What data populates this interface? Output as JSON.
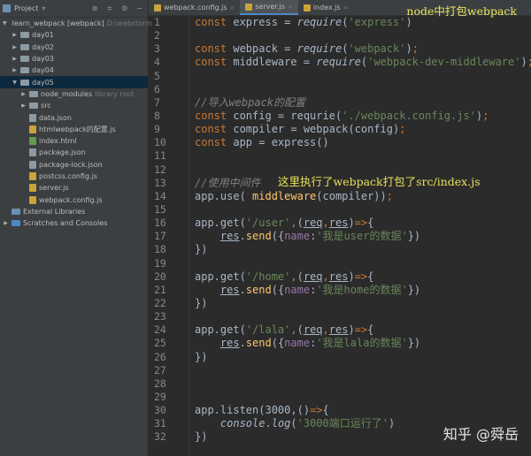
{
  "sidebar": {
    "title": "Project",
    "items": [
      {
        "label": "learn_webpack [webpack]",
        "hint": "D:\\webstorm",
        "depth": 0,
        "kind": "folder",
        "open": true
      },
      {
        "label": "day01",
        "depth": 1,
        "kind": "folder"
      },
      {
        "label": "day02",
        "depth": 1,
        "kind": "folder"
      },
      {
        "label": "day03",
        "depth": 1,
        "kind": "folder"
      },
      {
        "label": "day04",
        "depth": 1,
        "kind": "folder"
      },
      {
        "label": "day05",
        "depth": 1,
        "kind": "folder",
        "open": true,
        "selected": true
      },
      {
        "label": "node_modules",
        "hint": "library root",
        "depth": 2,
        "kind": "folder"
      },
      {
        "label": "src",
        "depth": 2,
        "kind": "folder"
      },
      {
        "label": "data.json",
        "depth": 2,
        "kind": "json"
      },
      {
        "label": "htmlwebpack的配置.js",
        "depth": 2,
        "kind": "js"
      },
      {
        "label": "index.html",
        "depth": 2,
        "kind": "html"
      },
      {
        "label": "package.json",
        "depth": 2,
        "kind": "json"
      },
      {
        "label": "package-lock.json",
        "depth": 2,
        "kind": "json"
      },
      {
        "label": "postcss.config.js",
        "depth": 2,
        "kind": "js"
      },
      {
        "label": "server.js",
        "depth": 2,
        "kind": "js"
      },
      {
        "label": "webpack.config.js",
        "depth": 2,
        "kind": "js"
      },
      {
        "label": "External Libraries",
        "depth": 0,
        "kind": "lib"
      },
      {
        "label": "Scratches and Consoles",
        "depth": 0,
        "kind": "scratch"
      }
    ]
  },
  "tabs": [
    {
      "label": "webpack.config.js"
    },
    {
      "label": "server.js",
      "active": true
    },
    {
      "label": "index.js"
    }
  ],
  "code": [
    [
      [
        "kw",
        "const "
      ],
      [
        "pl",
        "express = "
      ],
      [
        "it",
        "require"
      ],
      [
        "pl",
        "("
      ],
      [
        "str",
        "'express'"
      ],
      [
        "pl",
        ")"
      ]
    ],
    [],
    [
      [
        "kw",
        "const "
      ],
      [
        "pl",
        "webpack = "
      ],
      [
        "it",
        "require"
      ],
      [
        "pl",
        "("
      ],
      [
        "str",
        "'webpack'"
      ],
      [
        "pl",
        ")"
      ],
      [
        "kw",
        ";"
      ]
    ],
    [
      [
        "kw",
        "const "
      ],
      [
        "pl",
        "middleware = "
      ],
      [
        "it",
        "require"
      ],
      [
        "pl",
        "("
      ],
      [
        "str",
        "'webpack-dev-middleware'"
      ],
      [
        "pl",
        ")"
      ],
      [
        "kw",
        ";"
      ]
    ],
    [],
    [],
    [
      [
        "cm",
        "//导入webpack的配置"
      ]
    ],
    [
      [
        "kw",
        "const "
      ],
      [
        "pl",
        "config = requrie("
      ],
      [
        "str",
        "'./webpack.config.js'"
      ],
      [
        "pl",
        ")"
      ],
      [
        "kw",
        ";"
      ]
    ],
    [
      [
        "kw",
        "const "
      ],
      [
        "pl",
        "compiler = webpack(config)"
      ],
      [
        "kw",
        ";"
      ]
    ],
    [
      [
        "kw",
        "const "
      ],
      [
        "pl",
        "app = express()"
      ]
    ],
    [],
    [],
    [
      [
        "cm",
        "//使用中间件"
      ]
    ],
    [
      [
        "pl",
        "app.use( "
      ],
      [
        "fn",
        "middleware"
      ],
      [
        "pl",
        "(compiler))"
      ],
      [
        "kw",
        ";"
      ]
    ],
    [],
    [
      [
        "pl",
        "app.get("
      ],
      [
        "str",
        "'/user'"
      ],
      [
        "kw",
        ","
      ],
      [
        "pl",
        "("
      ],
      [
        "ul",
        "req"
      ],
      [
        "kw",
        ","
      ],
      [
        "ul",
        "res"
      ],
      [
        "pl",
        ")"
      ],
      [
        "kw",
        "=>"
      ],
      [
        "pl",
        "{"
      ]
    ],
    [
      [
        "pl",
        "    "
      ],
      [
        "ul",
        "res"
      ],
      [
        "pl",
        "."
      ],
      [
        "fn",
        "send"
      ],
      [
        "pl",
        "({"
      ],
      [
        "pr",
        "name"
      ],
      [
        "pl",
        ":"
      ],
      [
        "str",
        "'我是user的数据'"
      ],
      [
        "pl",
        "})"
      ]
    ],
    [
      [
        "pl",
        "})"
      ]
    ],
    [],
    [
      [
        "pl",
        "app.get("
      ],
      [
        "str",
        "'/home'"
      ],
      [
        "kw",
        ","
      ],
      [
        "pl",
        "("
      ],
      [
        "ul",
        "req"
      ],
      [
        "kw",
        ","
      ],
      [
        "ul",
        "res"
      ],
      [
        "pl",
        ")"
      ],
      [
        "kw",
        "=>"
      ],
      [
        "pl",
        "{"
      ]
    ],
    [
      [
        "pl",
        "    "
      ],
      [
        "ul",
        "res"
      ],
      [
        "pl",
        "."
      ],
      [
        "fn",
        "send"
      ],
      [
        "pl",
        "({"
      ],
      [
        "pr",
        "name"
      ],
      [
        "pl",
        ":"
      ],
      [
        "str",
        "'我是home的数据'"
      ],
      [
        "pl",
        "})"
      ]
    ],
    [
      [
        "pl",
        "})"
      ]
    ],
    [],
    [
      [
        "pl",
        "app.get("
      ],
      [
        "str",
        "'/lala'"
      ],
      [
        "kw",
        ","
      ],
      [
        "pl",
        "("
      ],
      [
        "ul",
        "req"
      ],
      [
        "kw",
        ","
      ],
      [
        "ul",
        "res"
      ],
      [
        "pl",
        ")"
      ],
      [
        "kw",
        "=>"
      ],
      [
        "pl",
        "{"
      ]
    ],
    [
      [
        "pl",
        "    "
      ],
      [
        "ul",
        "res"
      ],
      [
        "pl",
        "."
      ],
      [
        "fn",
        "send"
      ],
      [
        "pl",
        "({"
      ],
      [
        "pr",
        "name"
      ],
      [
        "pl",
        ":"
      ],
      [
        "str",
        "'我是lala的数据'"
      ],
      [
        "pl",
        "})"
      ]
    ],
    [
      [
        "pl",
        "})"
      ]
    ],
    [],
    [],
    [],
    [
      [
        "pl",
        "app.listen(3000,()"
      ],
      [
        "kw",
        "=>"
      ],
      [
        "pl",
        "{"
      ]
    ],
    [
      [
        "pl",
        "    "
      ],
      [
        "it",
        "console"
      ],
      [
        "pl",
        "."
      ],
      [
        "it",
        "log"
      ],
      [
        "pl",
        "("
      ],
      [
        "str",
        "'3000端口运行了'"
      ],
      [
        "pl",
        ")"
      ]
    ],
    [
      [
        "pl",
        "})"
      ]
    ]
  ],
  "annotations": {
    "title": "node中打包webpack",
    "note": "这里执行了webpack打包了src/index.js"
  },
  "watermark": "知乎 @舜岳"
}
